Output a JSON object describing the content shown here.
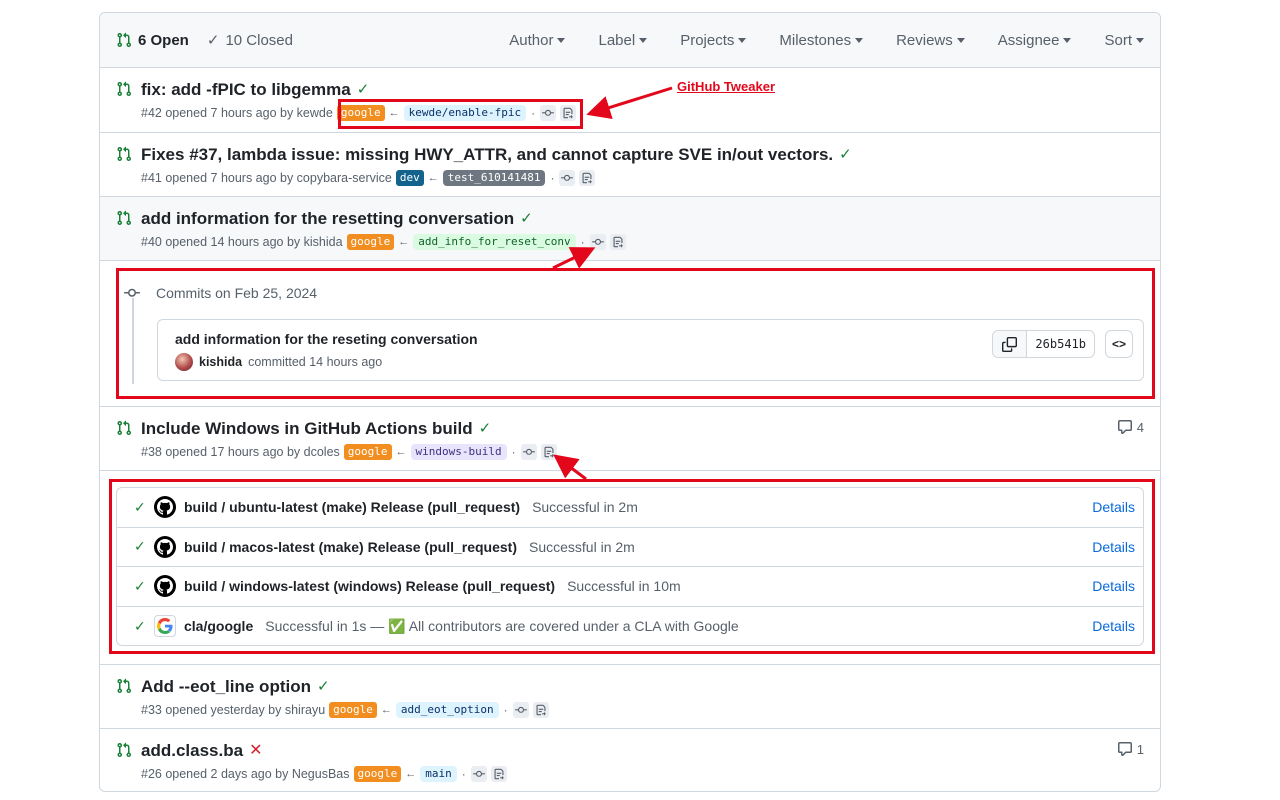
{
  "header": {
    "open_label": "6 Open",
    "closed_label": "10 Closed",
    "filters": [
      "Author",
      "Label",
      "Projects",
      "Milestones",
      "Reviews",
      "Assignee",
      "Sort"
    ]
  },
  "annotation": {
    "label": "GitHub Tweaker",
    "color": "#e3071b"
  },
  "prs": [
    {
      "title": "fix: add -fPIC to libgemma",
      "meta": "#42 opened 7 hours ago by kewde",
      "label": "google",
      "branch": "kewde/enable-fpic",
      "status": "success"
    },
    {
      "title": "Fixes #37, lambda issue: missing HWY_ATTR, and cannot capture SVE in/out vectors.",
      "meta": "#41 opened 7 hours ago by copybara-service",
      "label": "dev",
      "branch": "test_610141481",
      "status": "success"
    },
    {
      "title": "add information for the resetting conversation",
      "meta": "#40 opened 14 hours ago by kishida",
      "label": "google",
      "branch": "add_info_for_reset_conv",
      "status": "success"
    },
    {
      "title": "Include Windows in GitHub Actions build",
      "meta": "#38 opened 17 hours ago by dcoles",
      "label": "google",
      "branch": "windows-build",
      "status": "success",
      "comments": "4"
    },
    {
      "title": "Add --eot_line option",
      "meta": "#33 opened yesterday by shirayu",
      "label": "google",
      "branch": "add_eot_option",
      "status": "success"
    },
    {
      "title": "add.class.ba",
      "meta": "#26 opened 2 days ago by NegusBas",
      "label": "google",
      "branch": "main",
      "status": "failure",
      "comments": "1"
    }
  ],
  "commits": {
    "heading": "Commits on Feb 25, 2024",
    "message": "add information for the reseting conversation",
    "author": "kishida",
    "when": "committed 14 hours ago",
    "sha": "26b541b"
  },
  "checks": [
    {
      "name": "build / ubuntu-latest (make) Release (pull_request)",
      "status": "Successful in 2m",
      "details": "Details"
    },
    {
      "name": "build / macos-latest (make) Release (pull_request)",
      "status": "Successful in 2m",
      "details": "Details"
    },
    {
      "name": "build / windows-latest (windows) Release (pull_request)",
      "status": "Successful in 10m",
      "details": "Details"
    },
    {
      "name": "cla/google",
      "status": "Successful in 1s — ✅ All contributors are covered under a CLA with Google",
      "details": "Details"
    }
  ]
}
